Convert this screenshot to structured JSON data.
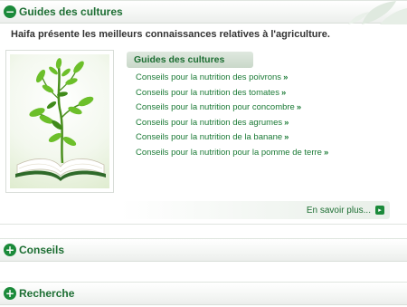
{
  "sections": {
    "guides": {
      "title": "Guides des cultures",
      "state": "expanded"
    },
    "conseils": {
      "title": "Conseils",
      "state": "collapsed"
    },
    "recherche": {
      "title": "Recherche",
      "state": "collapsed"
    }
  },
  "intro_text": "Haifa présente les meilleurs connaissances relatives à l'agriculture.",
  "guide_box": {
    "header": "Guides des cultures",
    "links": [
      "Conseils pour la nutrition des poivrons",
      "Conseils pour la nutrition des tomates",
      "Conseils pour la nutrition pour concombre",
      "Conseils pour la nutrition des agrumes",
      "Conseils pour la nutrition de la banane",
      "Conseils pour la nutrition pour la pomme de terre"
    ],
    "link_arrow": "»"
  },
  "more_label": "En savoir plus...",
  "icons": {
    "collapse": "−",
    "expand": "+",
    "more": "▸"
  },
  "colors": {
    "accent": "#1b8a3a",
    "title": "#1d6e33"
  }
}
